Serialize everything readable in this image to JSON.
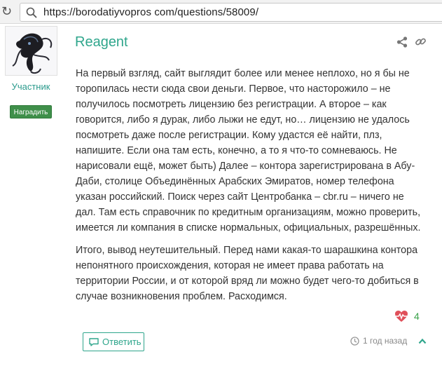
{
  "browser": {
    "url": "https://borodatiyvopros com/questions/58009/"
  },
  "sidebar": {
    "role": "Участник",
    "reward_label": "Наградить"
  },
  "post": {
    "author": "Reagent",
    "paragraphs": [
      "На первый взгляд, сайт выглядит более или менее неплохо, но я бы не торопилась нести сюда свои деньги. Первое, что насторожило – не получилось посмотреть лицензию без регистрации. А второе – как говорится, либо я дурак, либо лыжи не едут, но… лицензию не удалось посмотреть даже после регистрации. Кому удастся её найти, плз, напишите. Если она там есть, конечно, а то я что-то сомневаюсь. Не нарисовали ещё, может быть) Далее – контора зарегистрирована в Абу-Даби, столице Объединённых Арабских Эмиратов, номер телефона указан российский. Поиск через сайт Центробанка – cbr.ru – ничего не дал. Там есть справочник по кредитным организациям, можно проверить, имеется ли компания в списке нормальных, официальных, разрешённых.",
      "Итого, вывод неутешительный. Перед нами какая-то шарашкина контора непонятного происхождения, которая не имеет права работать на территории России, и от которой вряд ли можно будет чего-то добиться в случае возникновения проблем. Расходимся."
    ],
    "likes": "4",
    "reply_label": "Ответить",
    "time": "1 год назад"
  },
  "icons": {
    "reload": "reload-icon",
    "search": "search-icon",
    "share": "share-icon",
    "link": "link-icon",
    "heart": "heartbeat-icon",
    "reply": "comment-icon",
    "clock": "clock-icon",
    "chevron": "chevron-up-icon"
  },
  "colors": {
    "accent": "#2fa68c",
    "reward_bg": "#3f8f4a",
    "heart": "#e0505a",
    "likes": "#3aa24a"
  }
}
